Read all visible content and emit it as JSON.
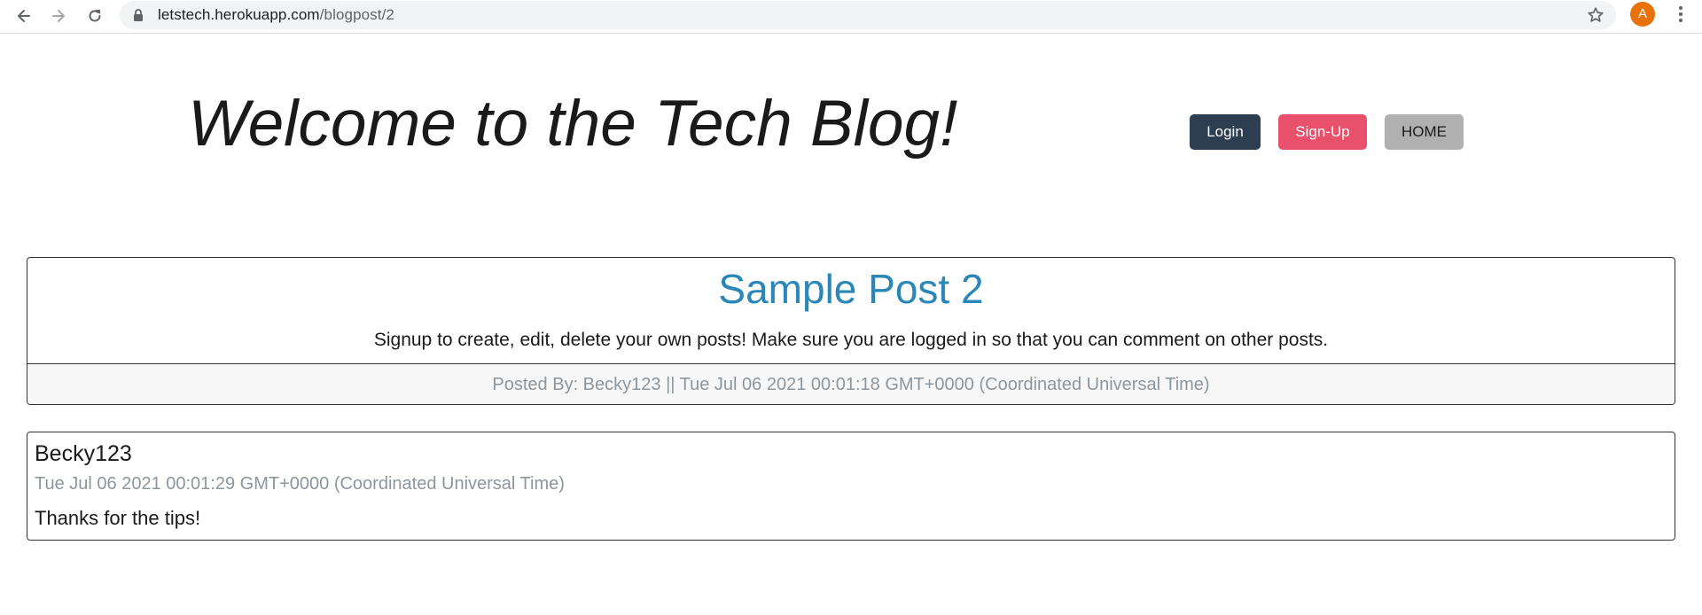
{
  "browser": {
    "url_host": "letstech.herokuapp.com",
    "url_path": "/blogpost/2",
    "avatar_letter": "A",
    "icons": [
      "back-arrow-icon",
      "forward-arrow-icon",
      "reload-icon",
      "lock-icon",
      "star-icon",
      "more-vert-icon"
    ]
  },
  "header": {
    "title": "Welcome to the Tech Blog!",
    "nav": {
      "login_label": "Login",
      "signup_label": "Sign-Up",
      "home_label": "HOME"
    }
  },
  "post": {
    "title": "Sample Post 2",
    "content": "Signup to create, edit, delete your own posts! Make sure you are logged in so that you can comment on other posts.",
    "footer": "Posted By: Becky123 || Tue Jul 06 2021 00:01:18 GMT+0000 (Coordinated Universal Time)"
  },
  "comments": [
    {
      "user": "Becky123",
      "date": "Tue Jul 06 2021 00:01:29 GMT+0000 (Coordinated Universal Time)",
      "text": "Thanks for the tips!"
    }
  ],
  "colors": {
    "login_bg": "#2c3e50",
    "signup_bg": "#e9506c",
    "home_bg": "#b0b0b0",
    "post_title": "#2a87b8",
    "muted_text": "#8d969c",
    "avatar_bg": "#e8710a"
  }
}
